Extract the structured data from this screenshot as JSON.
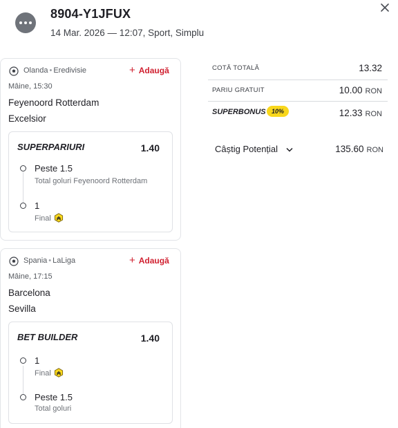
{
  "header": {
    "ticket_id": "8904-Y1JFUX",
    "meta": "14 Mar. 2026 — 12:07, Sport, Simplu"
  },
  "events": [
    {
      "league": {
        "country": "Olanda",
        "name": "Eredivisie"
      },
      "add_label": "Adaugă",
      "time": "Mâine, 15:30",
      "team_home": "Feyenoord Rotterdam",
      "team_away": "Excelsior",
      "bet": {
        "type": "SUPERPARIURI",
        "odds": "1.40",
        "selections": [
          {
            "name": "Peste 1.5",
            "market": "Total goluri Feyenoord Rotterdam"
          },
          {
            "name": "1",
            "market": "Final"
          }
        ]
      }
    },
    {
      "league": {
        "country": "Spania",
        "name": "LaLiga"
      },
      "add_label": "Adaugă",
      "time": "Mâine, 17:15",
      "team_home": "Barcelona",
      "team_away": "Sevilla",
      "bet": {
        "type": "BET BUILDER",
        "odds": "1.40",
        "selections": [
          {
            "name": "1",
            "market": "Final"
          },
          {
            "name": "Peste 1.5",
            "market": "Total goluri"
          }
        ]
      }
    }
  ],
  "summary": {
    "cota_totala": {
      "label": "COTĂ TOTALĂ",
      "value": "13.32"
    },
    "pariu_gratuit": {
      "label": "PARIU GRATUIT",
      "value": "10.00",
      "currency": "RON"
    },
    "superbonus": {
      "label": "SUPERBONUS",
      "badge": "10%",
      "value": "12.33",
      "currency": "RON"
    },
    "castig": {
      "label": "Câștig Potențial",
      "value": "135.60",
      "currency": "RON"
    }
  },
  "colors": {
    "accent_red": "#d02030",
    "badge_yellow": "#f9d71c"
  }
}
